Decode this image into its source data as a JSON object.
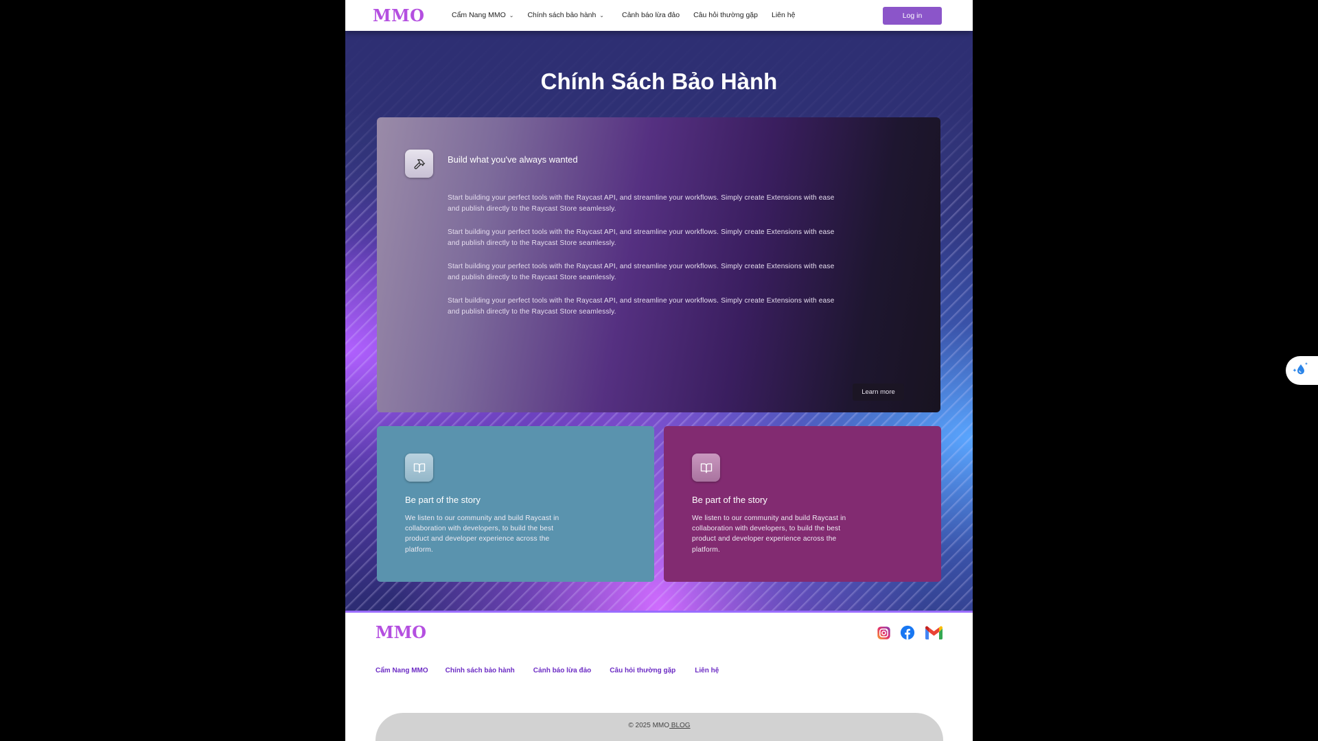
{
  "header": {
    "logo": "MMO",
    "nav": [
      {
        "label": "Cẩm Nang MMO",
        "has_dropdown": true
      },
      {
        "label": "Chính sách bảo hành",
        "has_dropdown": true
      },
      {
        "label": "Cảnh báo lừa đảo",
        "has_dropdown": false
      },
      {
        "label": "Câu hỏi thường gặp",
        "has_dropdown": false
      },
      {
        "label": "Liên hệ",
        "has_dropdown": false
      }
    ],
    "login_label": "Log in"
  },
  "hero": {
    "title": "Chính Sách Bảo Hành",
    "big_card": {
      "icon": "hammer-icon",
      "heading": "Build what you've always wanted",
      "paragraphs": [
        "Start building your perfect tools with the Raycast API, and streamline your workflows. Simply create Extensions with ease and publish directly to the Raycast Store seamlessly.",
        "Start building your perfect tools with the Raycast API, and streamline your workflows. Simply create Extensions with ease and publish directly to the Raycast Store seamlessly.",
        "Start building your perfect tools with the Raycast API, and streamline your workflows. Simply create Extensions with ease and publish directly to the Raycast Store seamlessly.",
        "Start building your perfect tools with the Raycast API, and streamline your workflows. Simply create Extensions with ease and publish directly to the Raycast Store seamlessly."
      ],
      "button_label": "Learn more"
    },
    "small_cards": [
      {
        "icon": "book-icon",
        "heading": "Be part of the story",
        "text": "We listen to our community and build Raycast in collaboration with developers, to build the best product and developer experience across the platform.",
        "color": "#5a93ae"
      },
      {
        "icon": "book-icon",
        "heading": "Be part of the story",
        "text": "We listen to our community and build Raycast in collaboration with developers, to build the best product and developer experience across the platform.",
        "color": "#822b71"
      }
    ]
  },
  "footer": {
    "logo": "MMO",
    "socials": [
      "instagram-icon",
      "facebook-icon",
      "gmail-icon"
    ],
    "nav": [
      "Cẩm Nang MMO",
      "Chính sách bảo hành",
      "Cảnh báo lừa đảo",
      "Câu hỏi thường gặp",
      "Liên hệ"
    ],
    "copyright_prefix": "© 2025 MMO",
    "copyright_link": " BLOG"
  },
  "colors": {
    "brand": "#b44fe0",
    "login_button": "#8b55c9",
    "footer_link": "#6c2cc4"
  }
}
